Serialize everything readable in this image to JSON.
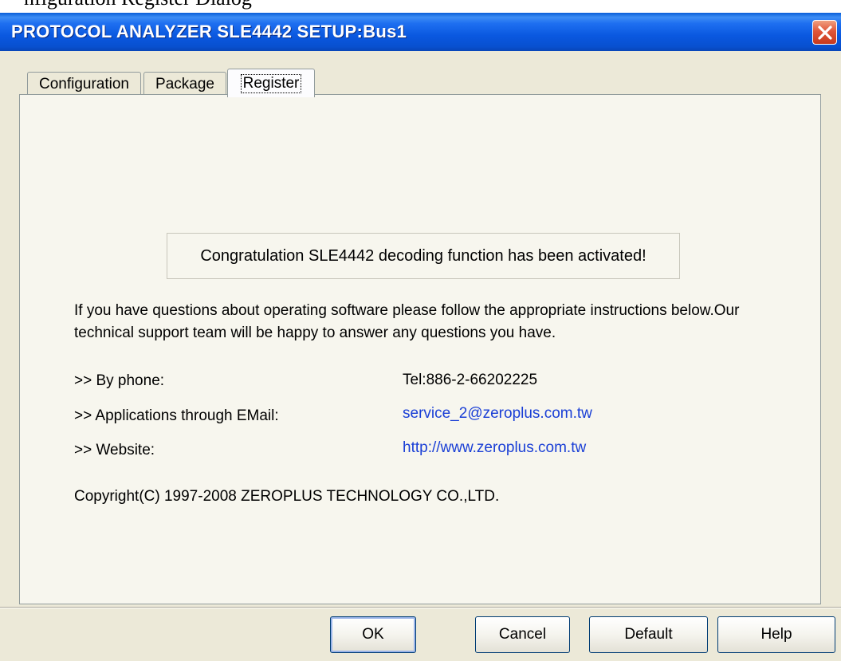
{
  "background_text": "nfiguration Register Dialog",
  "window": {
    "title": "PROTOCOL ANALYZER SLE4442 SETUP:Bus1"
  },
  "tabs": [
    {
      "label": "Configuration",
      "active": false
    },
    {
      "label": "Package",
      "active": false
    },
    {
      "label": "Register",
      "active": true
    }
  ],
  "register": {
    "status_message": "Congratulation SLE4442 decoding function has been activated!",
    "support_text": "If you have questions about operating software please follow the appropriate instructions below.Our technical support team will be happy to answer any questions you have.",
    "contacts": [
      {
        "label": ">> By phone:",
        "value": "Tel:886-2-66202225"
      },
      {
        "label": ">> Applications through EMail:",
        "value": "service_2@zeroplus.com.tw"
      },
      {
        "label": ">> Website:",
        "value": "http://www.zeroplus.com.tw"
      }
    ],
    "copyright": "Copyright(C) 1997-2008 ZEROPLUS TECHNOLOGY CO.,LTD."
  },
  "buttons": {
    "ok": "OK",
    "cancel": "Cancel",
    "default": "Default",
    "help": "Help"
  },
  "colors": {
    "titlebar": "#0a58e0",
    "dialog_face": "#ece9d8",
    "link": "#1a3fd6",
    "close_button": "#e0563a"
  },
  "icons": {
    "close": "close-icon"
  }
}
